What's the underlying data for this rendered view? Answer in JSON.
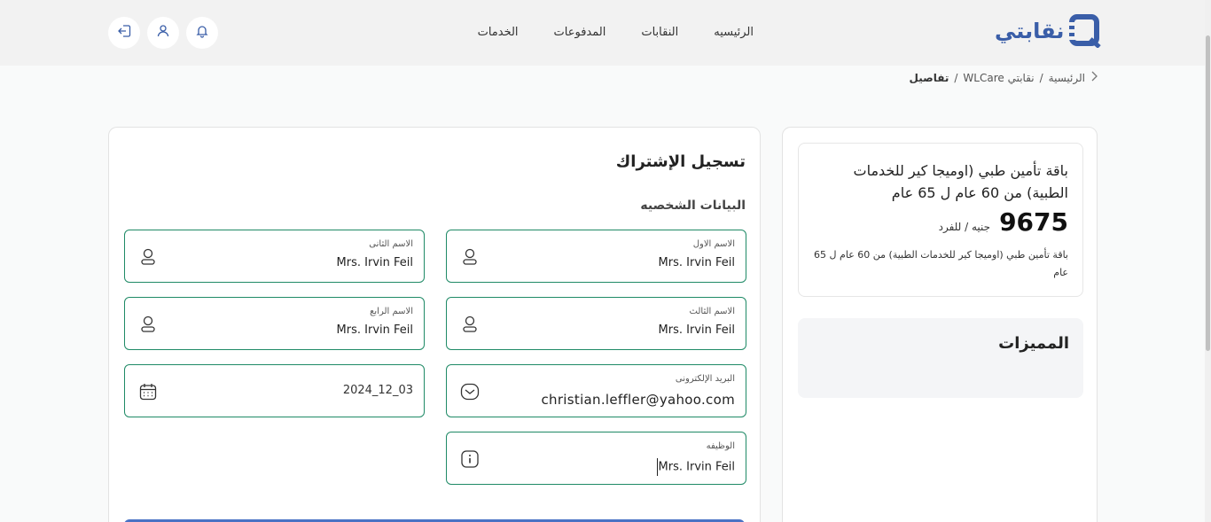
{
  "header": {
    "logo_text": "نقابتي",
    "nav": [
      "الرئيسيه",
      "النقابات",
      "المدفوعات",
      "الخدمات"
    ],
    "icons": [
      "notification-bell-icon",
      "user-icon",
      "logout-icon"
    ]
  },
  "breadcrumb": {
    "items": [
      "الرئيسية",
      "نقابتي WLCare"
    ],
    "current": "تفاصيل",
    "separator": "/"
  },
  "form": {
    "title": "تسجيل الإشتراك",
    "section": "البيانات الشخصيه",
    "fields": {
      "first_name": {
        "label": "الاسم الاول",
        "value": "Mrs. Irvin Feil"
      },
      "second_name": {
        "label": "الاسم الثانى",
        "value": "Mrs. Irvin Feil"
      },
      "third_name": {
        "label": "الاسم الثالث",
        "value": "Mrs. Irvin Feil"
      },
      "fourth_name": {
        "label": "الاسم الرابع",
        "value": "Mrs. Irvin Feil"
      },
      "email": {
        "label": "البريد الإلكترونى",
        "value": "christian.leffler@yahoo.com"
      },
      "birth_date": {
        "label": "",
        "value": "2024_12_03"
      },
      "job": {
        "label": "الوظيفه",
        "value": "Mrs. Irvin Feil"
      }
    }
  },
  "package": {
    "title": "باقة تأمين طبي (اوميجا كير للخدمات الطبية) من 60 عام ل 65 عام",
    "price": "9675",
    "price_unit": "جنيه / للفرد",
    "description": "باقة تأمين طبي (اوميجا كير للخدمات الطبية) من 60 عام ل 65 عام",
    "features_title": "المميزات"
  },
  "colors": {
    "accent": "#3a5ea8",
    "field_border": "#1f8a66",
    "submit": "#4a72c4"
  }
}
